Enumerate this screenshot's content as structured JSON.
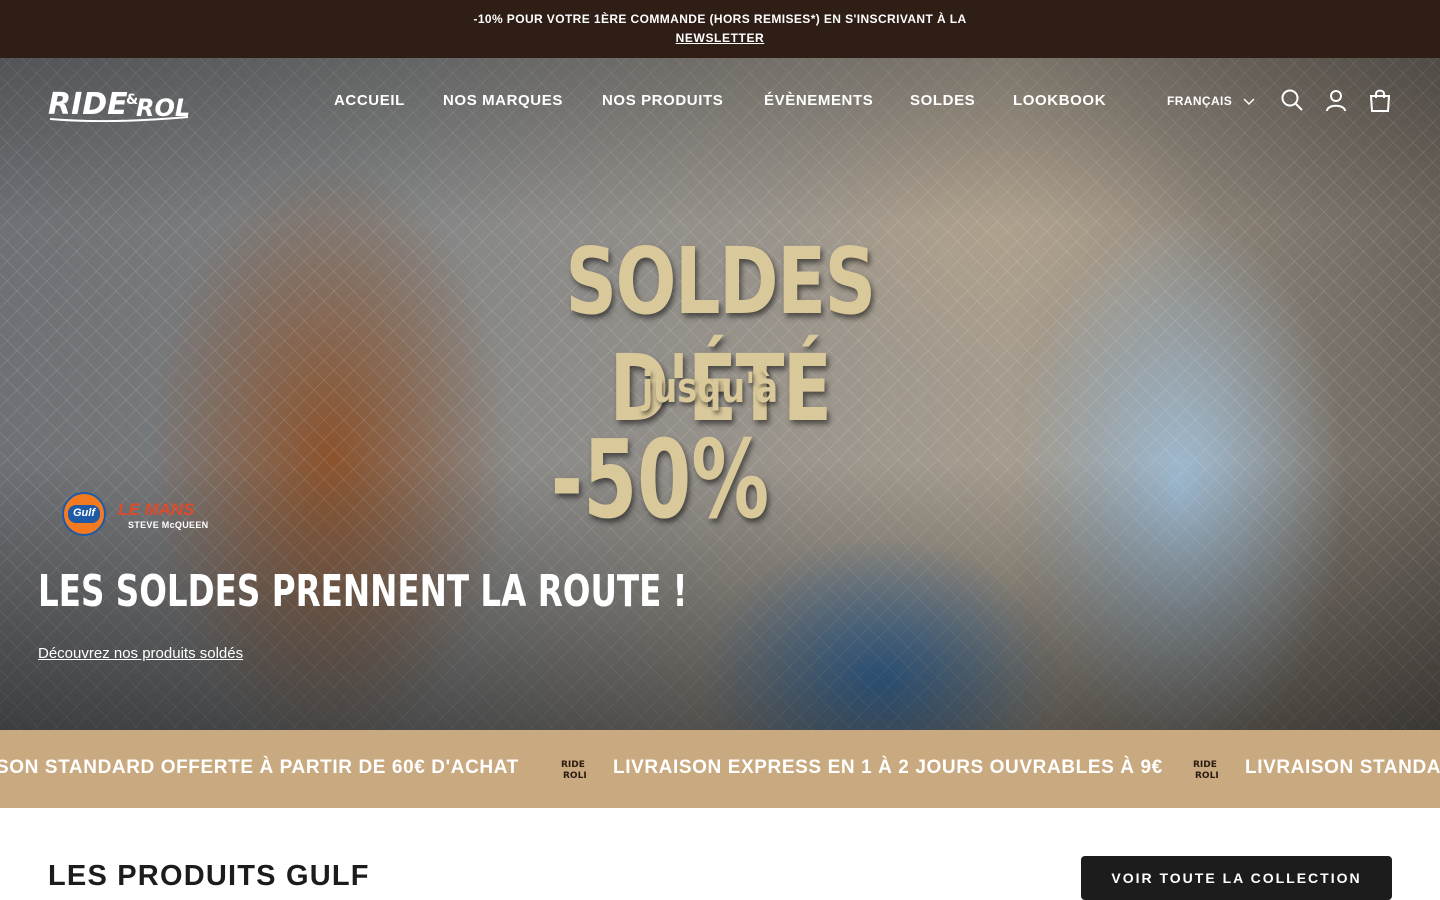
{
  "announcement": {
    "line1": "-10% POUR VOTRE 1ÈRE COMMANDE (HORS REMISES*) EN S'INSCRIVANT À LA",
    "link": "NEWSLETTER"
  },
  "header": {
    "logo_text": "RIDE & ROLL",
    "nav": [
      "ACCUEIL",
      "NOS MARQUES",
      "NOS PRODUITS",
      "ÉVÈNEMENTS",
      "SOLDES",
      "LOOKBOOK"
    ],
    "language": "FRANÇAIS",
    "icons": [
      "search-icon",
      "account-icon",
      "cart-icon"
    ]
  },
  "hero": {
    "promo_line1": "SOLDES D'ÉTÉ",
    "promo_line2": "jusqu'à",
    "promo_line3": "-50%",
    "brand_gulf": "Gulf",
    "brand_lemans": "LE MANS",
    "brand_lemans_sub": "STEVE McQUEEN",
    "title": "LES SOLDES PRENNENT LA ROUTE !",
    "link": "Découvrez nos produits soldés",
    "slides_total": 2,
    "active_slide": 2
  },
  "marquee": {
    "item1": "SON STANDARD OFFERTE À PARTIR DE 60€ D'ACHAT",
    "item2": "LIVRAISON EXPRESS EN 1 À 2 JOURS OUVRABLES À 9€",
    "item3": "LIVRAISON STANDA",
    "logo_line1": "RIDE",
    "logo_line2": "ROLL"
  },
  "section": {
    "title": "LES PRODUITS GULF",
    "cta": "VOIR TOUTE LA COLLECTION"
  },
  "colors": {
    "announcement_bg": "#2e1e15",
    "marquee_bg": "#c9a97f",
    "promo_text": "#d9c89a",
    "button_bg": "#1c1c1c"
  }
}
